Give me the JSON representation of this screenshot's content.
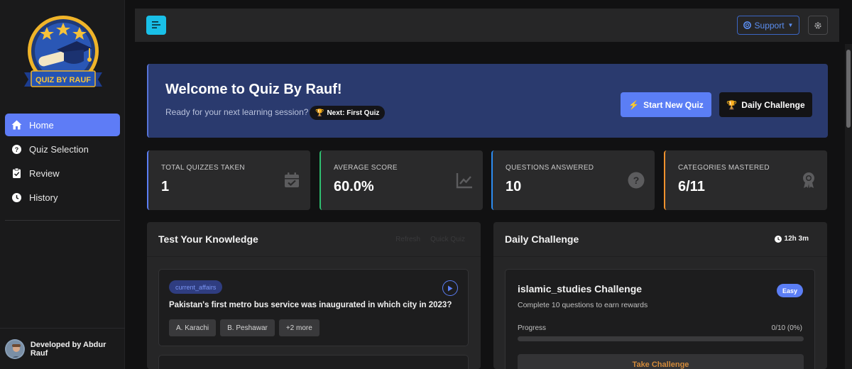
{
  "sidebar": {
    "logo_text": "QUIZ BY RAUF",
    "items": [
      {
        "label": "Home",
        "icon": "home-icon",
        "active": true
      },
      {
        "label": "Quiz Selection",
        "icon": "question-circle-icon"
      },
      {
        "label": "Review",
        "icon": "clipboard-check-icon"
      },
      {
        "label": "History",
        "icon": "clock-icon"
      }
    ],
    "footer": "Developed by Abdur Rauf"
  },
  "topbar": {
    "support_label": "Support",
    "colors": {
      "menu": "#19c0e8",
      "support": "#5b8ef0"
    }
  },
  "welcome": {
    "title": "Welcome to Quiz By Rauf!",
    "subtitle": "Ready for your next learning session?",
    "next_badge": "Next: First Quiz",
    "start_label": "Start New Quiz",
    "daily_label": "Daily Challenge"
  },
  "stats": [
    {
      "label": "TOTAL QUIZZES TAKEN",
      "value": "1",
      "icon": "calendar-check-icon",
      "accent": "#5b7ef5"
    },
    {
      "label": "AVERAGE SCORE",
      "value": "60.0%",
      "icon": "chart-line-icon",
      "accent": "#2fbf71"
    },
    {
      "label": "QUESTIONS ANSWERED",
      "value": "10",
      "icon": "question-circle-icon",
      "accent": "#2d8cf0"
    },
    {
      "label": "CATEGORIES MASTERED",
      "value": "6/11",
      "icon": "award-icon",
      "accent": "#f0922d"
    }
  ],
  "knowledge": {
    "title": "Test Your Knowledge",
    "ghost_refresh": "Refresh",
    "ghost_quick": "Quick Quiz",
    "question": {
      "tag": "current_affairs",
      "text": "Pakistan's first metro bus service was inaugurated in which city in 2023?",
      "options": [
        "A. Karachi",
        "B. Peshawar",
        "+2 more"
      ]
    }
  },
  "daily": {
    "title": "Daily Challenge",
    "timer": "12h 3m",
    "challenge_title": "islamic_studies Challenge",
    "challenge_sub": "Complete 10 questions to earn rewards",
    "difficulty": "Easy",
    "progress_label": "Progress",
    "progress_text": "0/10 (0%)",
    "progress_fraction": 0,
    "take_label": "Take Challenge"
  }
}
